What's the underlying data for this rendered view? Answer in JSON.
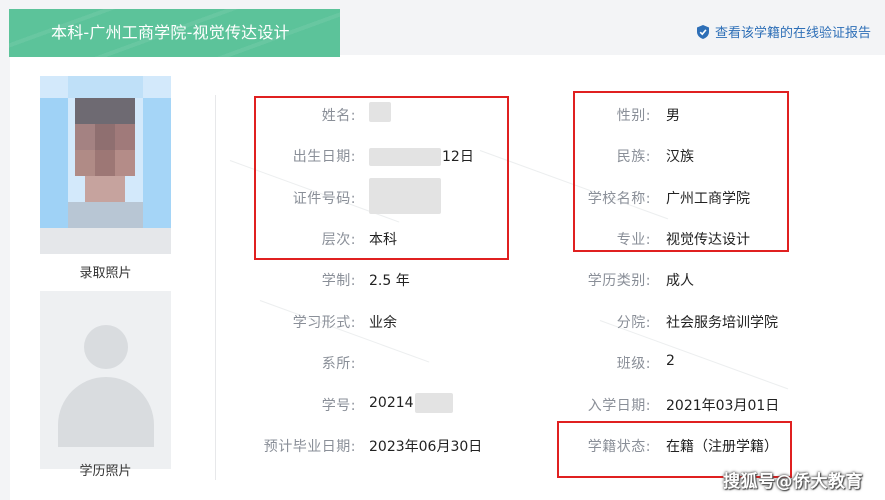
{
  "header": {
    "tab_title": "本科-广州工商学院-视觉传达设计",
    "verify_link": "查看该学籍的在线验证报告"
  },
  "photos": {
    "admission_label": "录取照片",
    "education_label": "学历照片"
  },
  "left_fields": [
    {
      "label": "姓名:",
      "value": ""
    },
    {
      "label": "出生日期:",
      "value": "12日"
    },
    {
      "label": "证件号码:",
      "value": ""
    },
    {
      "label": "层次:",
      "value": "本科"
    },
    {
      "label": "学制:",
      "value": "2.5 年"
    },
    {
      "label": "学习形式:",
      "value": "业余"
    },
    {
      "label": "系所:",
      "value": ""
    },
    {
      "label": "学号:",
      "value": "20214"
    },
    {
      "label": "预计毕业日期:",
      "value": "2023年06月30日"
    }
  ],
  "right_fields": [
    {
      "label": "性别:",
      "value": "男"
    },
    {
      "label": "民族:",
      "value": "汉族"
    },
    {
      "label": "学校名称:",
      "value": "广州工商学院"
    },
    {
      "label": "专业:",
      "value": "视觉传达设计"
    },
    {
      "label": "学历类别:",
      "value": "成人"
    },
    {
      "label": "分院:",
      "value": "社会服务培训学院"
    },
    {
      "label": "班级:",
      "value": "2"
    },
    {
      "label": "入学日期:",
      "value": "2021年03月01日"
    },
    {
      "label": "学籍状态:",
      "value": "在籍（注册学籍）"
    }
  ],
  "watermark": "搜狐号@侨大教育",
  "colors": {
    "tab_green": "#5cc39a",
    "link_blue": "#2e6fb7",
    "highlight_red": "#e02020",
    "label_gray": "#8a8f98"
  },
  "icons": {
    "verify": "shield-check-icon"
  }
}
